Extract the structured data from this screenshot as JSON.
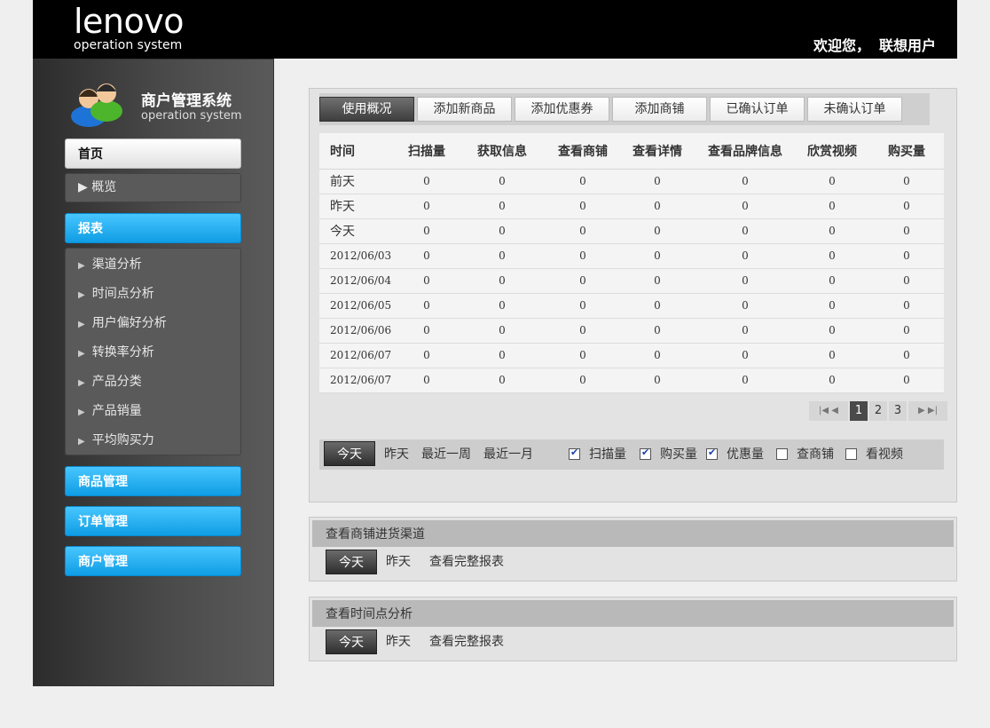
{
  "header": {
    "logo": "lenovo",
    "logo_sub": "operation system",
    "welcome": "欢迎您，",
    "user": "联想用户"
  },
  "sidebar": {
    "system_name": "商户管理系统",
    "system_sub": "operation system",
    "home": "首页",
    "home_sub": "▶ 概览",
    "reports": "报表",
    "report_items": [
      "渠道分析",
      "时间点分析",
      "用户偏好分析",
      "转换率分析",
      "产品分类",
      "产品销量",
      "平均购买力"
    ],
    "goods_mgmt": "商品管理",
    "order_mgmt": "订单管理",
    "merchant_mgmt": "商户管理"
  },
  "tabs": [
    "使用概况",
    "添加新商品",
    "添加优惠券",
    "添加商铺",
    "已确认订单",
    "未确认订单"
  ],
  "table": {
    "headers": [
      "时间",
      "扫描量",
      "获取信息",
      "查看商铺",
      "查看详情",
      "查看品牌信息",
      "欣赏视频",
      "购买量"
    ],
    "rows": [
      [
        "前天",
        "0",
        "0",
        "0",
        "0",
        "0",
        "0",
        "0"
      ],
      [
        "昨天",
        "0",
        "0",
        "0",
        "0",
        "0",
        "0",
        "0"
      ],
      [
        "今天",
        "0",
        "0",
        "0",
        "0",
        "0",
        "0",
        "0"
      ],
      [
        "2012/06/03",
        "0",
        "0",
        "0",
        "0",
        "0",
        "0",
        "0"
      ],
      [
        "2012/06/04",
        "0",
        "0",
        "0",
        "0",
        "0",
        "0",
        "0"
      ],
      [
        "2012/06/05",
        "0",
        "0",
        "0",
        "0",
        "0",
        "0",
        "0"
      ],
      [
        "2012/06/06",
        "0",
        "0",
        "0",
        "0",
        "0",
        "0",
        "0"
      ],
      [
        "2012/06/07",
        "0",
        "0",
        "0",
        "0",
        "0",
        "0",
        "0"
      ],
      [
        "2012/06/07",
        "0",
        "0",
        "0",
        "0",
        "0",
        "0",
        "0"
      ]
    ]
  },
  "pager": {
    "first": "|◀ ◀",
    "pages": [
      "1",
      "2",
      "3"
    ],
    "last": "▶ ▶|"
  },
  "filter": {
    "today": "今天",
    "yesterday": "昨天",
    "week": "最近一周",
    "month": "最近一月",
    "checks": [
      {
        "label": "扫描量",
        "checked": true
      },
      {
        "label": "购买量",
        "checked": true
      },
      {
        "label": "优惠量",
        "checked": true
      },
      {
        "label": "查商铺",
        "checked": false
      },
      {
        "label": "看视频",
        "checked": false
      }
    ]
  },
  "channel_box": {
    "title": "查看商铺进货渠道",
    "today": "今天",
    "yesterday": "昨天",
    "full": "查看完整报表"
  },
  "time_box": {
    "title": "查看时间点分析",
    "today": "今天",
    "yesterday": "昨天",
    "full": "查看完整报表"
  },
  "colors": {
    "accent_blue": "#1aa7ec",
    "header_bg": "#000000",
    "active_tab": "#4a4a4a"
  }
}
